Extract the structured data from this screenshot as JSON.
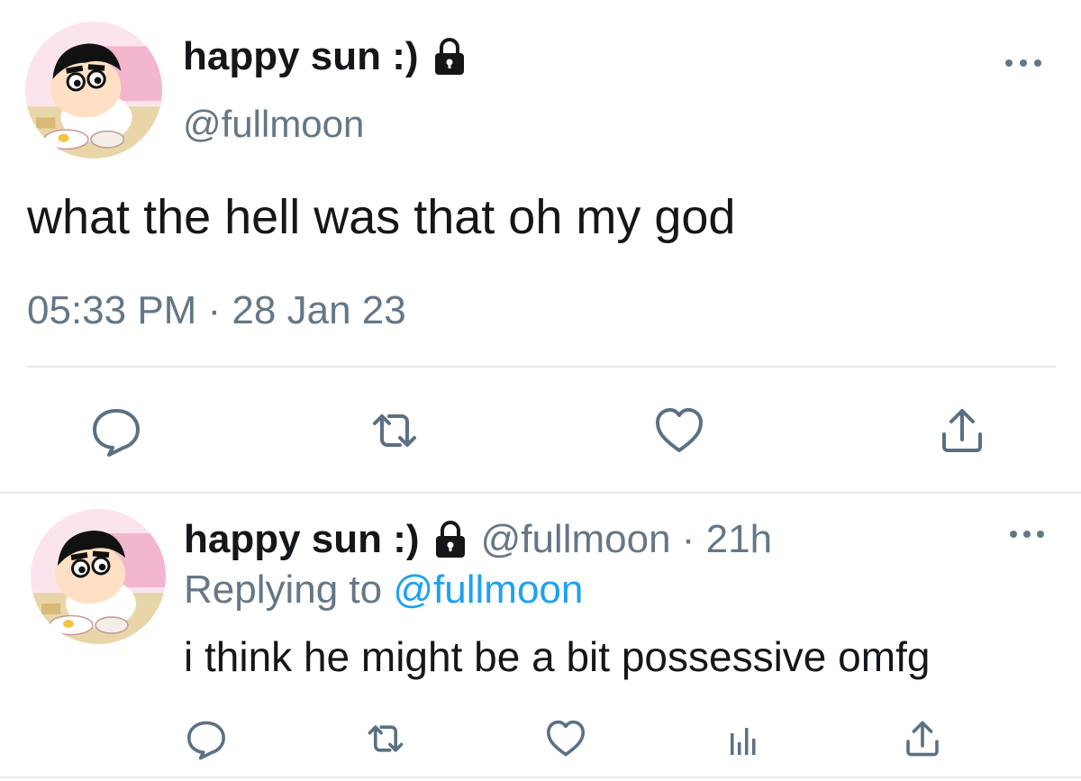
{
  "main_tweet": {
    "display_name": "happy sun :)",
    "handle": "@fullmoon",
    "text": "what the hell was that oh my god",
    "timestamp": "05:33 PM · 28 Jan 23",
    "avatar_icon": "cartoon-boy-avatar",
    "locked_icon": "lock-icon",
    "more_icon": "more-dots-icon",
    "actions": [
      "reply-icon",
      "retweet-icon",
      "like-icon",
      "share-icon"
    ]
  },
  "reply_tweet": {
    "display_name": "happy sun :)",
    "handle_time": "@fullmoon · 21h",
    "replying_prefix": "Replying to",
    "replying_mention": "@fullmoon",
    "text": "i think he might be a bit possessive omfg",
    "avatar_icon": "cartoon-boy-avatar",
    "locked_icon": "lock-icon",
    "more_icon": "more-dots-icon",
    "actions": [
      "reply-icon",
      "retweet-icon",
      "like-icon",
      "stats-icon",
      "share-icon"
    ]
  },
  "colors": {
    "text_primary": "#14171a",
    "text_secondary": "#657786",
    "accent": "#1da1f2",
    "icon": "#5b7083",
    "divider": "#e1e8ed"
  }
}
